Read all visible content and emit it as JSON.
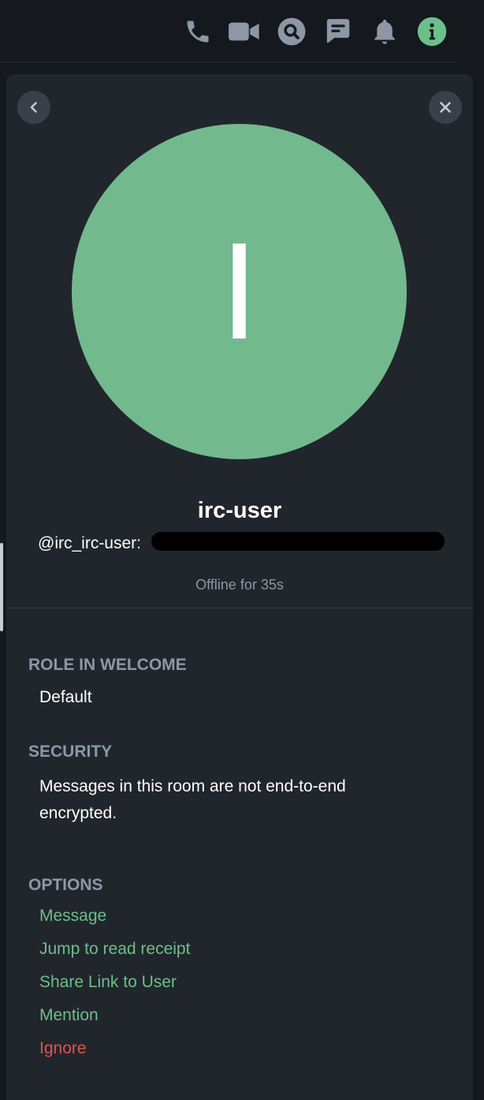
{
  "header": {
    "icons": [
      "phone-icon",
      "video-icon",
      "search-icon",
      "threads-icon",
      "bell-icon",
      "info-icon"
    ]
  },
  "user": {
    "avatar_letter": "I",
    "display_name": "irc-user",
    "mxid_visible": "@irc_irc-user:",
    "presence": "Offline for 35s",
    "avatar_color": "#73b98e"
  },
  "role": {
    "heading": "ROLE IN WELCOME",
    "value": "Default"
  },
  "security": {
    "heading": "SECURITY",
    "text": "Messages in this room are not end-to-end encrypted."
  },
  "options": {
    "heading": "OPTIONS",
    "items": [
      {
        "label": "Message",
        "kind": "ok"
      },
      {
        "label": "Jump to read receipt",
        "kind": "ok"
      },
      {
        "label": "Share Link to User",
        "kind": "ok"
      },
      {
        "label": "Mention",
        "kind": "ok"
      },
      {
        "label": "Ignore",
        "kind": "danger"
      }
    ]
  },
  "colors": {
    "accent": "#0dbd8b",
    "link": "#6cbf8a",
    "danger": "#e2544a",
    "panel": "#21262c",
    "background": "#15191e"
  }
}
